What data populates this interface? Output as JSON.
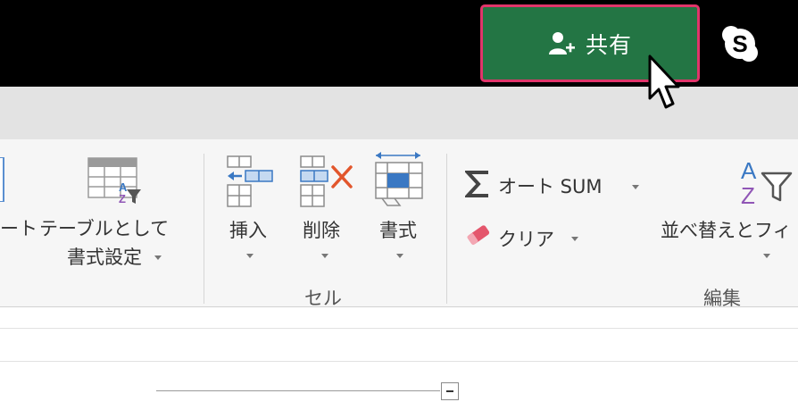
{
  "titlebar": {
    "share_label": "共有",
    "icons": {
      "share": "add-person-icon",
      "skype": "skype-icon"
    }
  },
  "ribbon": {
    "styles": {
      "format_partial": "ート",
      "format_as_table_line1": "テーブルとして",
      "format_as_table_line2": "書式設定"
    },
    "cells": {
      "insert": "挿入",
      "delete": "削除",
      "format": "書式",
      "group_label": "セル"
    },
    "editing": {
      "autosum": "オート SUM",
      "clear": "クリア",
      "sort_filter": "並べ替えとフィ",
      "group_label": "編集"
    }
  },
  "colors": {
    "share_green": "#237544",
    "highlight_border": "#e1346a",
    "delete_x": "#e2562c",
    "eraser": "#e4566c"
  }
}
